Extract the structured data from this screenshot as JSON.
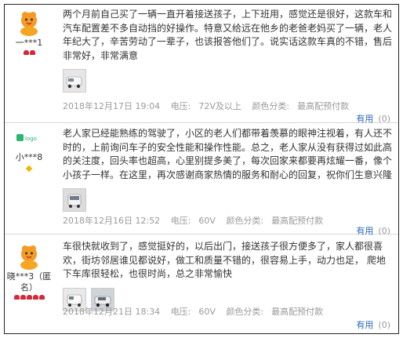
{
  "reviews": [
    {
      "username": "一***1",
      "badge_count": 2,
      "text": "两个月前自己买了一辆一直开着接送孩子，上下班用，感觉还是很好，这款车和汽车配置差不多自动挡的好操作。特意又给远在他乡的老爸老妈买了一辆，老人年纪大了，辛苦劳动了一辈子，也该报答他们了。说实话这款车真的不错，售后非常好，非常满意",
      "date": "2018年12月17日 19:04",
      "voltage_label": "电压:",
      "voltage": "72V及以上",
      "color_label": "颜色分类:",
      "color": "最高配预付款",
      "useful_label": "有用",
      "useful_count": "(0)"
    },
    {
      "username": "小***8",
      "badge_count": 1,
      "text": "老人家已经能熟练的驾驶了，小区的老人们都带着羡慕的眼神注视着，有人还不时的，上前询问车子的安全性能和操作性能。总之，老人家从没有获得过如此高的关注度，回头率也超高，心里别提多美了，每次回家来都要再炫耀一番，像个小孩子一样。在这里，再次感谢商家热情的服务和耐心的回复，祝你们生意兴隆",
      "date": "2018年12月16日 12:52",
      "voltage_label": "电压:",
      "voltage": "60V",
      "color_label": "颜色分类:",
      "color": "最高配预付款",
      "useful_label": "有用",
      "useful_count": "(0)"
    },
    {
      "username": "晓***3（匿名）",
      "badge_count": 5,
      "text": "车很快就收到了，感觉挺好的，以后出门，接送孩子很方便多了，家人都很喜欢，街坊邻居谁见都说好，做工和质量不错的，很容易上手，动力也足， 爬地下车库很轻松，也很时尚，总之非常愉快",
      "date": "2018年12月21日 18:34",
      "voltage_label": "电压:",
      "voltage": "60V",
      "color_label": "颜色分类:",
      "color": "最高配预付款",
      "useful_label": "有用",
      "useful_count": "(0)"
    }
  ],
  "colors": {
    "border": "#222222",
    "link": "#2a6ab8",
    "meta": "#9a9a9a",
    "badge": "#d5293a"
  }
}
